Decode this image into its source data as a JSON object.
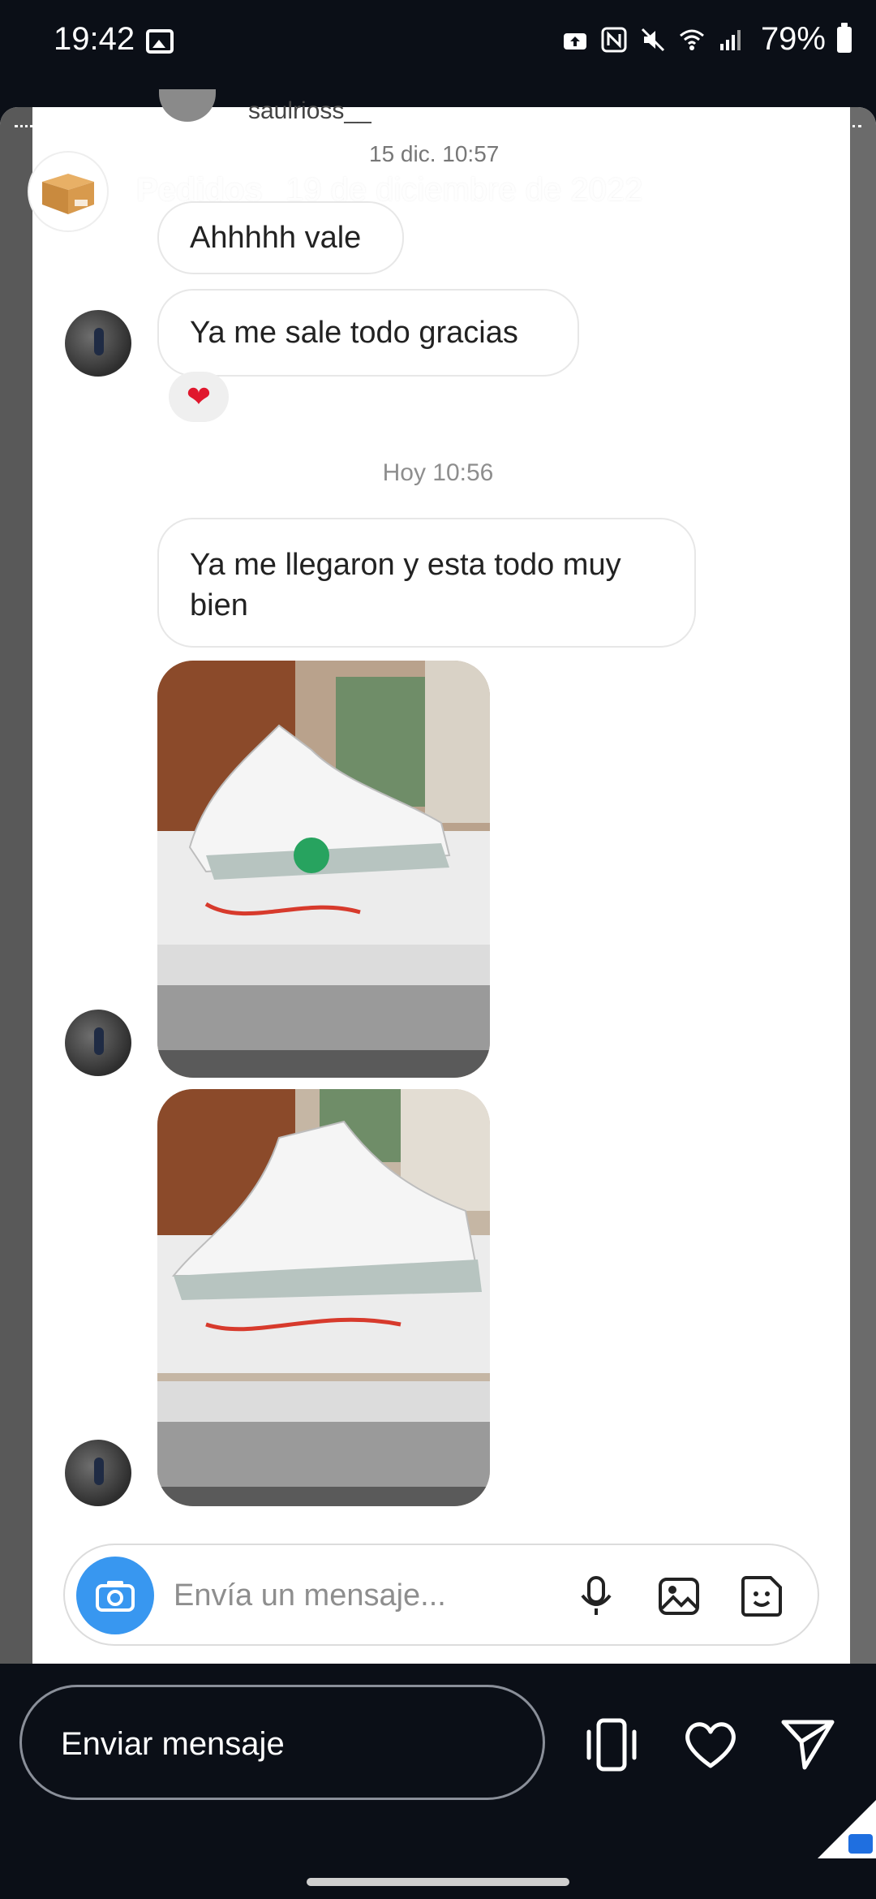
{
  "status_bar": {
    "time": "19:42",
    "battery_percent": "79%"
  },
  "under": {
    "username": "saulrioss__",
    "ghost_timestamp": "15 dic. 10:57"
  },
  "story": {
    "title": "Pedidos",
    "date": "19 de diciembre de 2022"
  },
  "chat": {
    "messages": [
      {
        "text": "Ahhhhh vale"
      },
      {
        "text": "Ya me sale todo gracias"
      },
      {
        "text": "Ya me llegaron y esta todo muy bien"
      }
    ],
    "reaction": "❤",
    "timestamp": "Hoy 10:56"
  },
  "composer": {
    "placeholder": "Envía un mensaje..."
  },
  "bottom": {
    "reply_label": "Enviar mensaje"
  },
  "colors": {
    "accent": "#3897f0",
    "background": "#0b0f17",
    "heart": "#e0172d"
  }
}
